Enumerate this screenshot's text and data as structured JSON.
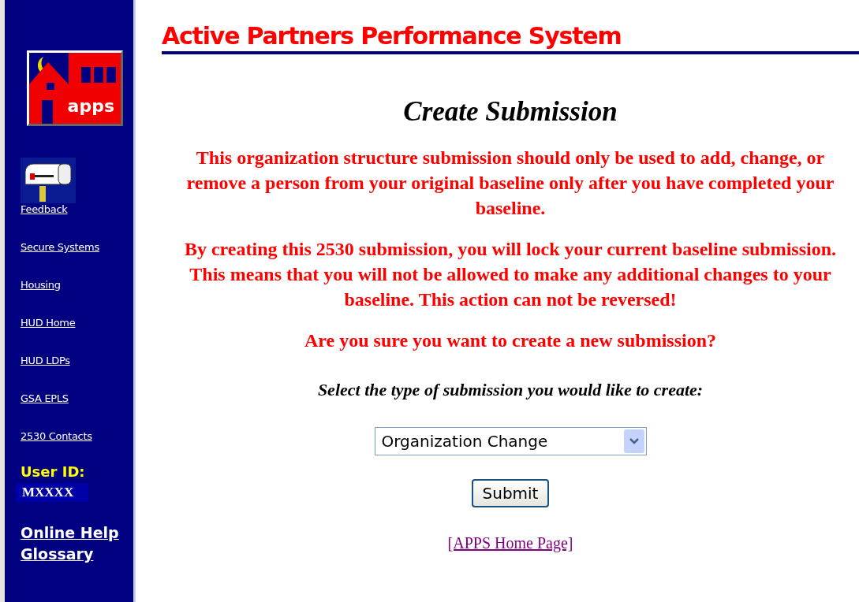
{
  "sidebar": {
    "logo_text": "apps",
    "feedback": "Feedback",
    "links": [
      "Secure Systems",
      "Housing",
      "HUD Home",
      "HUD LDPs",
      "GSA EPLS",
      "2530 Contacts"
    ],
    "user_id_label": "User ID:",
    "user_id": "MXXXX",
    "help_links": [
      "Online Help",
      "Glossary"
    ]
  },
  "header": {
    "title": "Active Partners Performance System"
  },
  "main": {
    "heading": "Create Submission",
    "warnings": [
      "This organization structure submission should only be used to add, change, or remove a person from your original baseline only after you have completed your baseline.",
      "By creating this 2530 submission, you will lock your current baseline submission. This means that you will not be allowed to make any additional changes to your baseline. This action can not be reversed!",
      "Are you sure you want to create a new submission?"
    ],
    "prompt": "Select the type of submission you would like to create:",
    "select": {
      "value": "Organization Change"
    },
    "submit": "Submit",
    "home_link": "[APPS Home Page]"
  }
}
